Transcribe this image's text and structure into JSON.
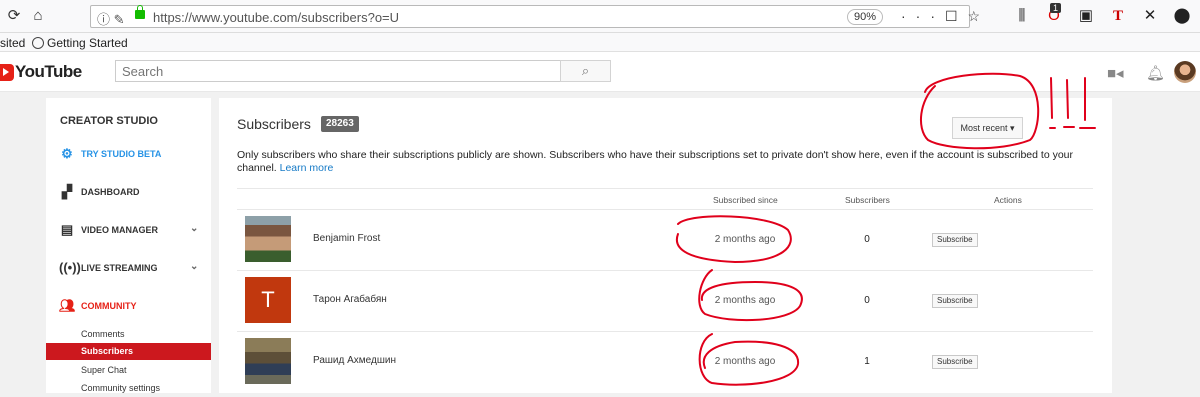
{
  "browser": {
    "url": "https://www.youtube.com/subscribers?o=U",
    "zoom": "90%",
    "ext_badge": "1",
    "bookmarks": {
      "visited": "sited",
      "getting_started": "Getting Started"
    }
  },
  "header": {
    "logo": "YouTube",
    "search_placeholder": "Search"
  },
  "sidebar": {
    "title": "CREATOR STUDIO",
    "items": [
      {
        "label": "TRY STUDIO BETA",
        "icon": "gear-icon",
        "color": "#2793e6"
      },
      {
        "label": "DASHBOARD",
        "icon": "dashboard-icon"
      },
      {
        "label": "VIDEO MANAGER",
        "icon": "video-manager-icon"
      },
      {
        "label": "LIVE STREAMING",
        "icon": "live-streaming-icon"
      },
      {
        "label": "COMMUNITY",
        "icon": "community-icon",
        "color": "#e62117"
      }
    ],
    "sub_items": [
      "Comments",
      "Subscribers",
      "Super Chat",
      "Community settings"
    ]
  },
  "main": {
    "title": "Subscribers",
    "count": "28263",
    "sort_label": "Most recent",
    "info": "Only subscribers who share their subscriptions publicly are shown. Subscribers who have their subscriptions set to private don't show here, even if the account is subscribed to your channel.",
    "learn_more": "Learn more",
    "columns": {
      "since": "Subscribed since",
      "subscribers": "Subscribers",
      "actions": "Actions"
    },
    "rows": [
      {
        "name": "Benjamin Frost",
        "since": "2 months ago",
        "subscribers": "0",
        "action": "Subscribe"
      },
      {
        "name": "Тарон Агабабян",
        "since": "2 months ago",
        "subscribers": "0",
        "action": "Subscribe",
        "avatar_letter": "T"
      },
      {
        "name": "Рашид Ахмедшин",
        "since": "2 months ago",
        "subscribers": "1",
        "action": "Subscribe"
      }
    ]
  },
  "annotation": {
    "text": "!!!",
    "color": "#e0001b"
  }
}
